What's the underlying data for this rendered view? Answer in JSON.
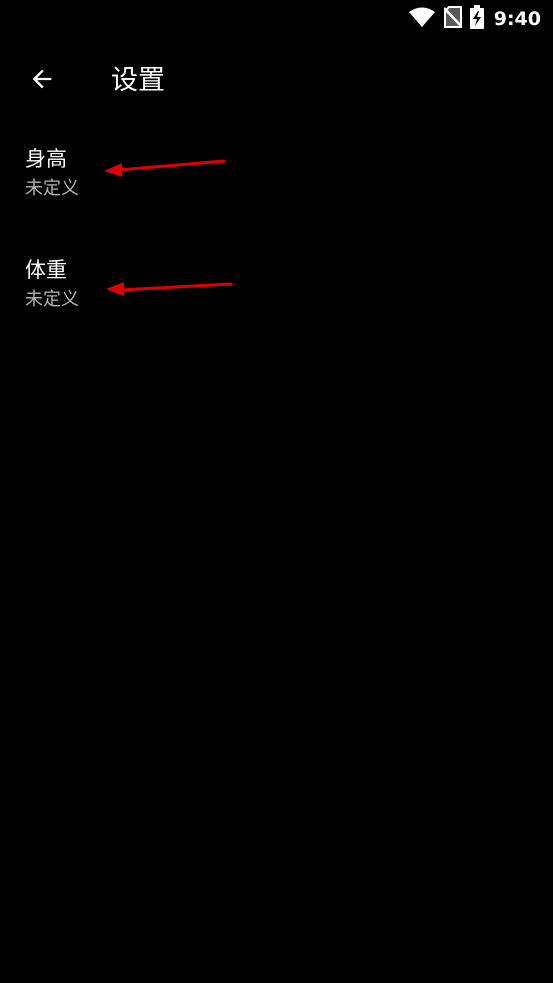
{
  "status_bar": {
    "time": "9:40",
    "icons": [
      "wifi-icon",
      "no-sim-icon",
      "battery-charging-icon"
    ]
  },
  "app_bar": {
    "title": "设置",
    "back_icon": "arrow-back-icon"
  },
  "preferences": [
    {
      "title": "身高",
      "summary": "未定义"
    },
    {
      "title": "体重",
      "summary": "未定义"
    }
  ],
  "colors": {
    "background": "#000000",
    "primary_text": "#ffffff",
    "secondary_text": "#b3b3b3",
    "annotation": "#e00000"
  }
}
